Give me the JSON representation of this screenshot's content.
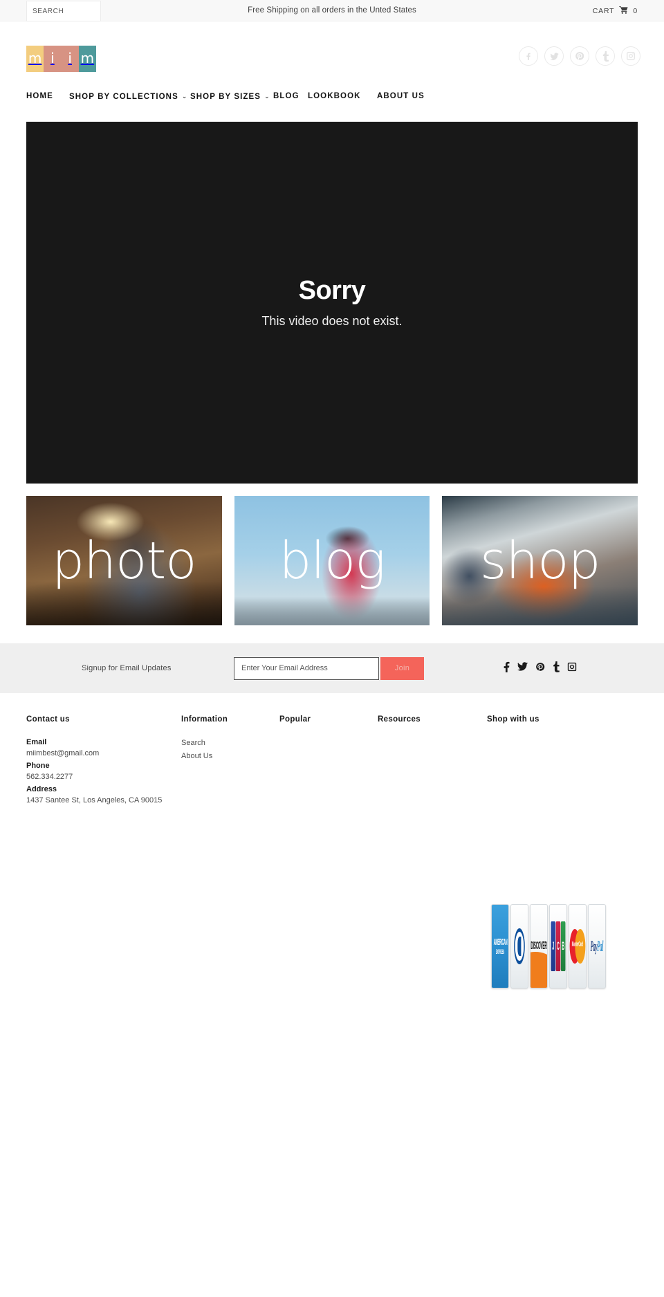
{
  "announcement": {
    "search_placeholder": "SEARCH",
    "search_value": "",
    "shipping_text": "Free Shipping on all orders in the Unted States",
    "cart_label": "CART",
    "cart_icon": "shopping-cart-icon",
    "cart_count": "0"
  },
  "header": {
    "logo_letters": [
      "m",
      "i",
      "i",
      "m"
    ],
    "logo_colors": [
      "#f3cd7f",
      "#d79383",
      "#d79383",
      "#4e9a9b"
    ],
    "social": [
      {
        "name": "facebook",
        "label": "f"
      },
      {
        "name": "twitter",
        "label": "t"
      },
      {
        "name": "pinterest",
        "label": "p"
      },
      {
        "name": "tumblr",
        "label": "t"
      },
      {
        "name": "instagram",
        "label": "i"
      }
    ]
  },
  "nav": {
    "items": [
      {
        "label": "HOME",
        "caret": ""
      },
      {
        "label": "SHOP BY COLLECTIONS",
        "caret": "⌄"
      },
      {
        "label": "SHOP BY SIZES",
        "caret": "⌄"
      },
      {
        "label": "BLOG",
        "caret": ""
      },
      {
        "label": "LOOKBOOK",
        "caret": ""
      },
      {
        "label": "ABOUT US",
        "caret": ""
      }
    ]
  },
  "hero": {
    "error_title": "Sorry",
    "error_message": "This video does not exist."
  },
  "tiles": [
    {
      "label": "photo",
      "name": "photo"
    },
    {
      "label": "blog",
      "name": "blog"
    },
    {
      "label": "shop",
      "name": "shop"
    }
  ],
  "newsletter": {
    "label": "Signup for Email Updates",
    "email_placeholder": "Enter Your Email Address",
    "email_value": "",
    "join_label": "Join",
    "join_color": "#f4645a",
    "social": [
      {
        "name": "facebook"
      },
      {
        "name": "twitter"
      },
      {
        "name": "pinterest"
      },
      {
        "name": "tumblr"
      },
      {
        "name": "instagram"
      }
    ]
  },
  "footer": {
    "contact": {
      "heading": "Contact us",
      "email_label": "Email",
      "email_value": "miimbest@gmail.com",
      "phone_label": "Phone",
      "phone_value": "562.334.2277",
      "address_label": "Address",
      "address_value": "1437 Santee St, Los Angeles, CA 90015"
    },
    "information": {
      "heading": "Information",
      "links": [
        "Search",
        "About Us"
      ]
    },
    "popular": {
      "heading": "Popular",
      "links": []
    },
    "resources": {
      "heading": "Resources",
      "links": []
    },
    "shop_with_us": {
      "heading": "Shop with us",
      "links": []
    },
    "payments": [
      {
        "name": "american-express",
        "line1": "AMERICAN",
        "line2": "EXPRESS"
      },
      {
        "name": "diners-club",
        "line1": "",
        "line2": ""
      },
      {
        "name": "discover",
        "line1": "DISCOVER",
        "line2": ""
      },
      {
        "name": "jcb",
        "line1": "JCB",
        "line2": ""
      },
      {
        "name": "mastercard",
        "line1": "MasterCard",
        "line2": ""
      },
      {
        "name": "paypal",
        "line1": "Pay",
        "line2": "Pal"
      }
    ]
  }
}
